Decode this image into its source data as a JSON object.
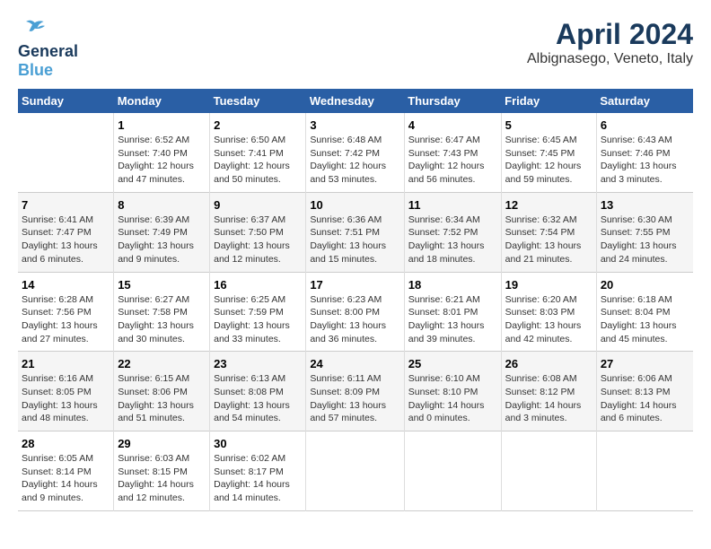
{
  "header": {
    "logo_line1": "General",
    "logo_line2": "Blue",
    "month_year": "April 2024",
    "location": "Albignasego, Veneto, Italy"
  },
  "days_of_week": [
    "Sunday",
    "Monday",
    "Tuesday",
    "Wednesday",
    "Thursday",
    "Friday",
    "Saturday"
  ],
  "weeks": [
    [
      {
        "day": "",
        "content": ""
      },
      {
        "day": "1",
        "content": "Sunrise: 6:52 AM\nSunset: 7:40 PM\nDaylight: 12 hours\nand 47 minutes."
      },
      {
        "day": "2",
        "content": "Sunrise: 6:50 AM\nSunset: 7:41 PM\nDaylight: 12 hours\nand 50 minutes."
      },
      {
        "day": "3",
        "content": "Sunrise: 6:48 AM\nSunset: 7:42 PM\nDaylight: 12 hours\nand 53 minutes."
      },
      {
        "day": "4",
        "content": "Sunrise: 6:47 AM\nSunset: 7:43 PM\nDaylight: 12 hours\nand 56 minutes."
      },
      {
        "day": "5",
        "content": "Sunrise: 6:45 AM\nSunset: 7:45 PM\nDaylight: 12 hours\nand 59 minutes."
      },
      {
        "day": "6",
        "content": "Sunrise: 6:43 AM\nSunset: 7:46 PM\nDaylight: 13 hours\nand 3 minutes."
      }
    ],
    [
      {
        "day": "7",
        "content": "Sunrise: 6:41 AM\nSunset: 7:47 PM\nDaylight: 13 hours\nand 6 minutes."
      },
      {
        "day": "8",
        "content": "Sunrise: 6:39 AM\nSunset: 7:49 PM\nDaylight: 13 hours\nand 9 minutes."
      },
      {
        "day": "9",
        "content": "Sunrise: 6:37 AM\nSunset: 7:50 PM\nDaylight: 13 hours\nand 12 minutes."
      },
      {
        "day": "10",
        "content": "Sunrise: 6:36 AM\nSunset: 7:51 PM\nDaylight: 13 hours\nand 15 minutes."
      },
      {
        "day": "11",
        "content": "Sunrise: 6:34 AM\nSunset: 7:52 PM\nDaylight: 13 hours\nand 18 minutes."
      },
      {
        "day": "12",
        "content": "Sunrise: 6:32 AM\nSunset: 7:54 PM\nDaylight: 13 hours\nand 21 minutes."
      },
      {
        "day": "13",
        "content": "Sunrise: 6:30 AM\nSunset: 7:55 PM\nDaylight: 13 hours\nand 24 minutes."
      }
    ],
    [
      {
        "day": "14",
        "content": "Sunrise: 6:28 AM\nSunset: 7:56 PM\nDaylight: 13 hours\nand 27 minutes."
      },
      {
        "day": "15",
        "content": "Sunrise: 6:27 AM\nSunset: 7:58 PM\nDaylight: 13 hours\nand 30 minutes."
      },
      {
        "day": "16",
        "content": "Sunrise: 6:25 AM\nSunset: 7:59 PM\nDaylight: 13 hours\nand 33 minutes."
      },
      {
        "day": "17",
        "content": "Sunrise: 6:23 AM\nSunset: 8:00 PM\nDaylight: 13 hours\nand 36 minutes."
      },
      {
        "day": "18",
        "content": "Sunrise: 6:21 AM\nSunset: 8:01 PM\nDaylight: 13 hours\nand 39 minutes."
      },
      {
        "day": "19",
        "content": "Sunrise: 6:20 AM\nSunset: 8:03 PM\nDaylight: 13 hours\nand 42 minutes."
      },
      {
        "day": "20",
        "content": "Sunrise: 6:18 AM\nSunset: 8:04 PM\nDaylight: 13 hours\nand 45 minutes."
      }
    ],
    [
      {
        "day": "21",
        "content": "Sunrise: 6:16 AM\nSunset: 8:05 PM\nDaylight: 13 hours\nand 48 minutes."
      },
      {
        "day": "22",
        "content": "Sunrise: 6:15 AM\nSunset: 8:06 PM\nDaylight: 13 hours\nand 51 minutes."
      },
      {
        "day": "23",
        "content": "Sunrise: 6:13 AM\nSunset: 8:08 PM\nDaylight: 13 hours\nand 54 minutes."
      },
      {
        "day": "24",
        "content": "Sunrise: 6:11 AM\nSunset: 8:09 PM\nDaylight: 13 hours\nand 57 minutes."
      },
      {
        "day": "25",
        "content": "Sunrise: 6:10 AM\nSunset: 8:10 PM\nDaylight: 14 hours\nand 0 minutes."
      },
      {
        "day": "26",
        "content": "Sunrise: 6:08 AM\nSunset: 8:12 PM\nDaylight: 14 hours\nand 3 minutes."
      },
      {
        "day": "27",
        "content": "Sunrise: 6:06 AM\nSunset: 8:13 PM\nDaylight: 14 hours\nand 6 minutes."
      }
    ],
    [
      {
        "day": "28",
        "content": "Sunrise: 6:05 AM\nSunset: 8:14 PM\nDaylight: 14 hours\nand 9 minutes."
      },
      {
        "day": "29",
        "content": "Sunrise: 6:03 AM\nSunset: 8:15 PM\nDaylight: 14 hours\nand 12 minutes."
      },
      {
        "day": "30",
        "content": "Sunrise: 6:02 AM\nSunset: 8:17 PM\nDaylight: 14 hours\nand 14 minutes."
      },
      {
        "day": "",
        "content": ""
      },
      {
        "day": "",
        "content": ""
      },
      {
        "day": "",
        "content": ""
      },
      {
        "day": "",
        "content": ""
      }
    ]
  ]
}
